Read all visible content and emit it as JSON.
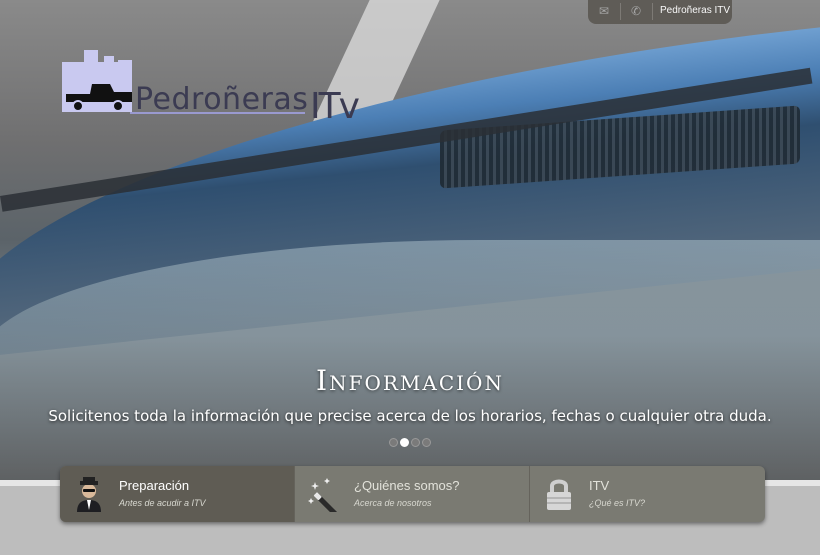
{
  "topbar": {
    "brand": "Pedroñeras ITV",
    "icons": [
      "mail-icon",
      "phone-icon"
    ]
  },
  "logo": {
    "title": "Pedroñeras",
    "suffix": "ITv"
  },
  "slider": {
    "title": "Información",
    "subtitle": "Solicitenos toda la información que precise acerca de los horarios, fechas o cualquier otra duda.",
    "slide_count": 4,
    "active_slide": 2
  },
  "tabs": [
    {
      "title": "Preparación",
      "subtitle": "Antes de acudir a ITV",
      "icon": "inspector-icon",
      "active": true
    },
    {
      "title": "¿Quiénes somos?",
      "subtitle": "Acerca de nosotros",
      "icon": "magic-wand-icon",
      "active": false
    },
    {
      "title": "ITV",
      "subtitle": "¿Qué es ITV?",
      "icon": "lock-icon",
      "active": false
    }
  ],
  "colors": {
    "tab_bar": "#7a7a72",
    "tab_active": "#5f5c54",
    "logo_accent": "#9a9ad0"
  }
}
